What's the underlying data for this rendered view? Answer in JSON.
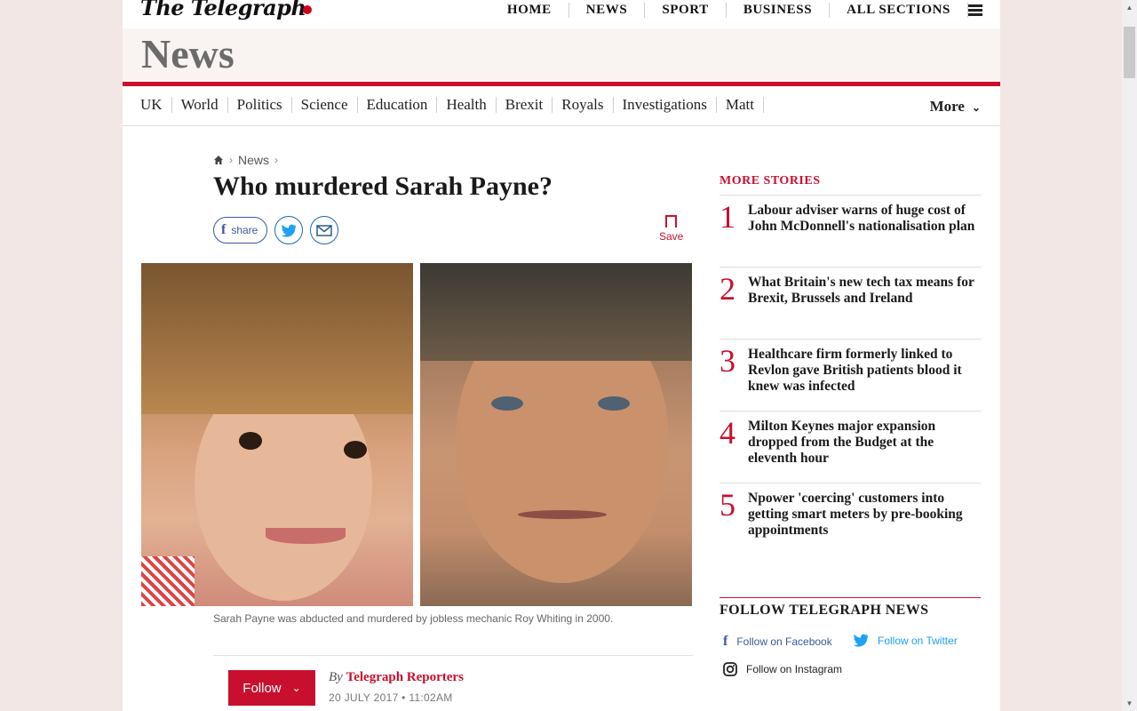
{
  "brand": {
    "logo_text": "The Telegraph"
  },
  "topnav": [
    {
      "label": "HOME"
    },
    {
      "label": "NEWS"
    },
    {
      "label": "SPORT"
    },
    {
      "label": "BUSINESS"
    },
    {
      "label": "ALL SECTIONS"
    }
  ],
  "section": {
    "title": "News"
  },
  "subnav": {
    "items": [
      {
        "label": "UK"
      },
      {
        "label": "World"
      },
      {
        "label": "Politics"
      },
      {
        "label": "Science"
      },
      {
        "label": "Education"
      },
      {
        "label": "Health"
      },
      {
        "label": "Brexit"
      },
      {
        "label": "Royals"
      },
      {
        "label": "Investigations"
      },
      {
        "label": "Matt"
      }
    ],
    "more_label": "More"
  },
  "breadcrumb": {
    "items": [
      {
        "label": "News"
      }
    ]
  },
  "article": {
    "headline": "Who murdered Sarah Payne?",
    "share_label": "share",
    "save_label": "Save",
    "caption": "Sarah Payne was abducted and murdered by jobless mechanic Roy Whiting in 2000.",
    "follow_label": "Follow",
    "by_prefix": "By",
    "author": "Telegraph Reporters",
    "date": "20 JULY 2017 • 11:02AM"
  },
  "sidebar": {
    "more_stories_heading": "MORE STORIES",
    "stories": [
      {
        "num": "1",
        "title": "Labour adviser warns of huge cost of John McDonnell's nationalisation  plan"
      },
      {
        "num": "2",
        "title": "What Britain's new tech tax means for Brexit, Brussels and Ireland"
      },
      {
        "num": "3",
        "title": "Healthcare firm formerly linked to Revlon gave British patients blood it knew was infected"
      },
      {
        "num": "4",
        "title": "Milton Keynes major expansion dropped from the Budget at the eleventh hour"
      },
      {
        "num": "5",
        "title": "Npower 'coercing' customers into getting smart meters by pre-booking appointments"
      }
    ],
    "follow_heading": "FOLLOW TELEGRAPH NEWS",
    "social": {
      "facebook": "Follow on Facebook",
      "twitter": "Follow on Twitter",
      "instagram": "Follow on Instagram"
    }
  },
  "colors": {
    "accent": "#c8102e",
    "facebook": "#3b5998",
    "twitter": "#1da1f2"
  }
}
